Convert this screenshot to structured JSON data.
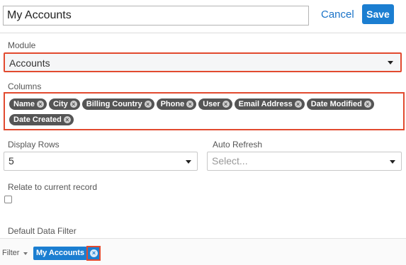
{
  "header": {
    "title_value": "My Accounts",
    "cancel_label": "Cancel",
    "save_label": "Save"
  },
  "module": {
    "label": "Module",
    "selected": "Accounts"
  },
  "columns": {
    "label": "Columns",
    "pills": [
      "Name",
      "City",
      "Billing Country",
      "Phone",
      "User",
      "Email Address",
      "Date Modified",
      "Date Created"
    ]
  },
  "display_rows": {
    "label": "Display Rows",
    "selected": "5"
  },
  "auto_refresh": {
    "label": "Auto Refresh",
    "placeholder": "Select..."
  },
  "relate": {
    "label": "Relate to current record"
  },
  "default_filter": {
    "label": "Default Data Filter"
  },
  "filter_bar": {
    "label": "Filter",
    "active_filter": "My Accounts"
  },
  "colors": {
    "accent": "#1b7ed1",
    "highlight": "#e24a2f",
    "pill": "#555555"
  }
}
